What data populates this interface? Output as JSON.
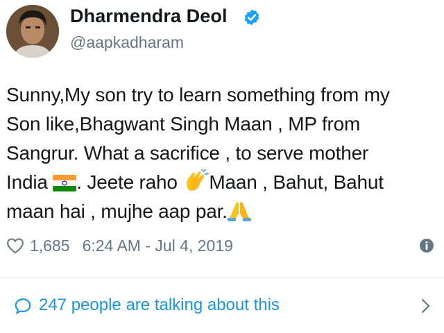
{
  "author": {
    "display_name": "Dharmendra Deol",
    "handle": "@aapkadharam",
    "verified": true
  },
  "tweet": {
    "lines": [
      "Sunny,My son try to learn something from my",
      "Son like,Bhagwant Singh Maan , MP from",
      "Sangrur. What a sacrifice , to serve mother"
    ],
    "line4_part1": "India ",
    "line4_part2": ". Jeete raho ",
    "line4_part3": "Maan , Bahut, Bahut",
    "line5": "maan hai , mujhe aap par.",
    "emojis": [
      "india-flag",
      "clapping-hands",
      "folded-hands"
    ]
  },
  "stats": {
    "likes": "1,685",
    "timestamp": "6:24 AM - Jul 4, 2019"
  },
  "conversation": {
    "label": "247 people are talking about this"
  },
  "colors": {
    "text": "#14171a",
    "secondary": "#657786",
    "link": "#1b95e0",
    "verified": "#1da1f2"
  }
}
